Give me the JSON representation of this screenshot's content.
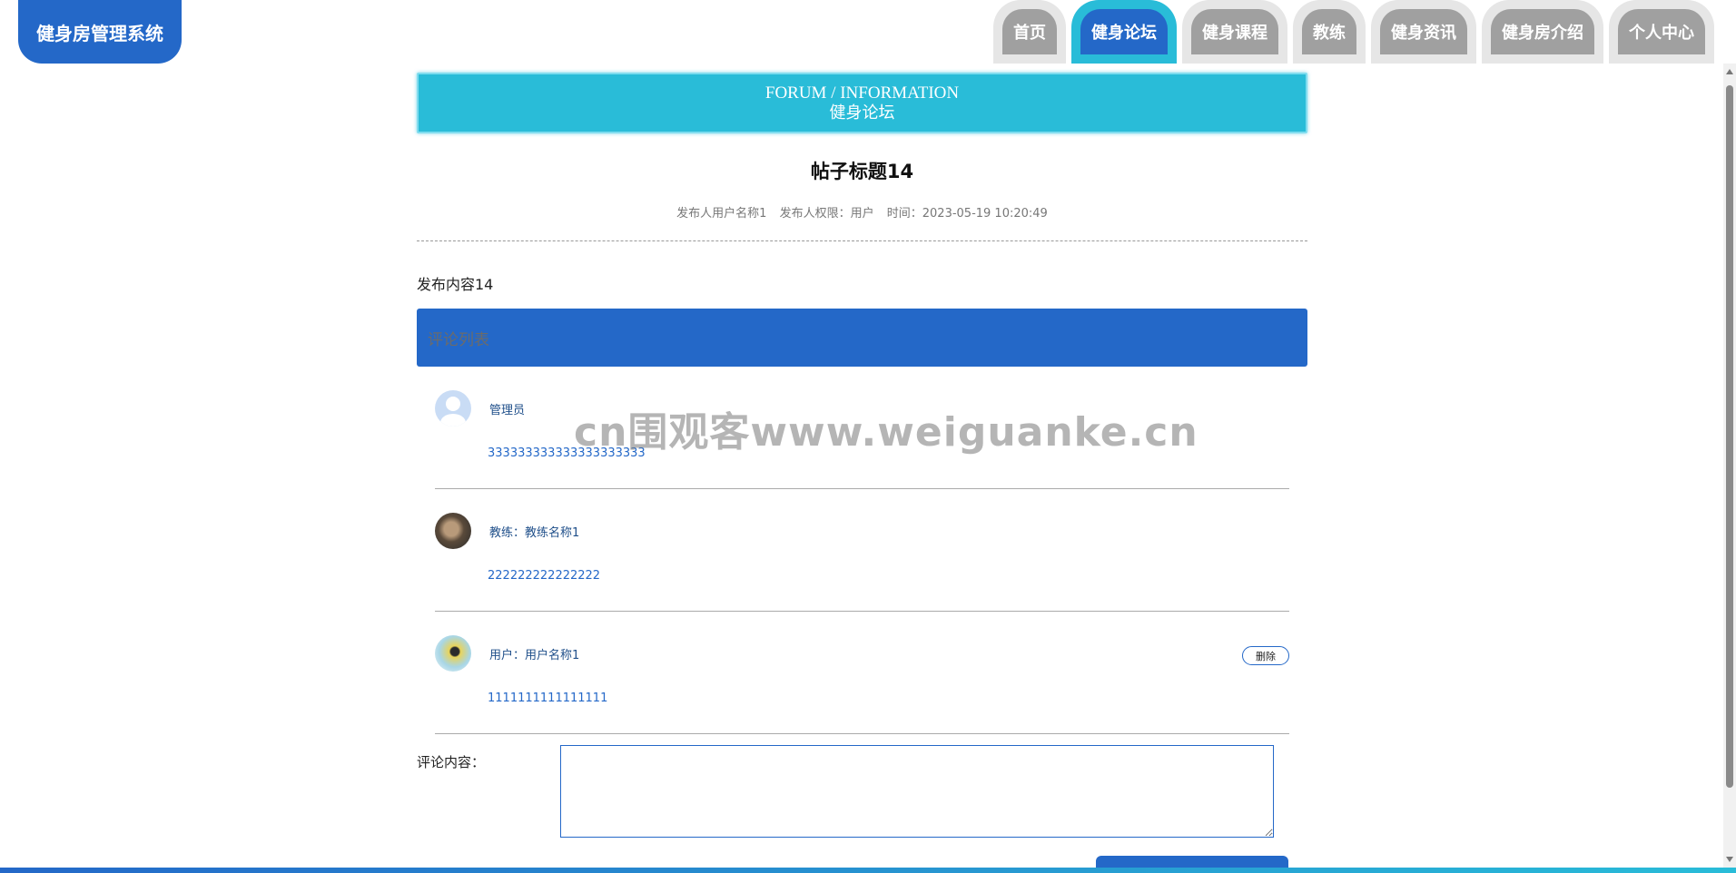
{
  "header": {
    "logo": "健身房管理系统",
    "nav": [
      "首页",
      "健身论坛",
      "健身课程",
      "教练",
      "健身资讯",
      "健身房介绍",
      "个人中心"
    ],
    "active_nav": "健身论坛"
  },
  "banner": {
    "en": "FORUM / INFORMATION",
    "cn": "健身论坛"
  },
  "post": {
    "title": "帖子标题14",
    "author": "发布人用户名称1",
    "role": "发布人权限：用户",
    "time": "时间：2023-05-19 10:20:49",
    "content": "发布内容14"
  },
  "comments_header": "评论列表",
  "comments": [
    {
      "author": "管理员",
      "text": "333333333333333333333",
      "avatar_icon": "default-avatar-icon"
    },
    {
      "author": "教练：教练名称1",
      "text": "222222222222222",
      "avatar_icon": "coach-photo-avatar"
    },
    {
      "author": "用户：用户名称1",
      "text": "1111111111111111",
      "avatar_icon": "user-photo-avatar",
      "delete_label": "删除"
    }
  ],
  "comment_form": {
    "label": "评论内容：",
    "value": ""
  },
  "watermark": "cn围观客www.weiguanke.cn",
  "colors": {
    "primary": "#2468c8",
    "accent": "#29bcd8",
    "nav_inactive": "#a0a0a0"
  }
}
